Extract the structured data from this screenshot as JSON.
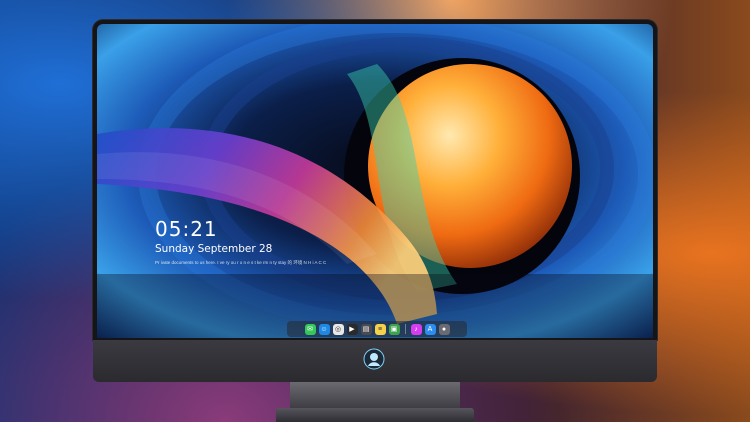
{
  "lockscreen": {
    "time": "05:21",
    "date": "Sunday September  28",
    "tagline": "Pr  ivate  documents  to us here.  I  ve  ry  ou  r  o  n  e  s  t  ke  rm   n  ty    stay 的 环境  N  H  i  A  C  C"
  },
  "dock": {
    "apps": [
      {
        "name": "messages-icon",
        "color": "#34c759",
        "glyph": "✉"
      },
      {
        "name": "finder-icon",
        "color": "#1e88e5",
        "glyph": "☺"
      },
      {
        "name": "safari-icon",
        "color": "#e8e8e8",
        "glyph": "◎"
      },
      {
        "name": "final-cut-icon",
        "color": "#2a2a2a",
        "glyph": "▶"
      },
      {
        "name": "claquette-icon",
        "color": "#4a4a52",
        "glyph": "▤"
      },
      {
        "name": "notes-icon",
        "color": "#f5d04a",
        "glyph": "≡"
      },
      {
        "name": "photos-icon",
        "color": "#3fa34d",
        "glyph": "▣"
      },
      {
        "name": "itunes-icon",
        "color": "#d63df0",
        "glyph": "♪"
      },
      {
        "name": "app-store-icon",
        "color": "#2d8cf0",
        "glyph": "A"
      },
      {
        "name": "camera-icon",
        "color": "#6a6a72",
        "glyph": "●"
      }
    ]
  }
}
